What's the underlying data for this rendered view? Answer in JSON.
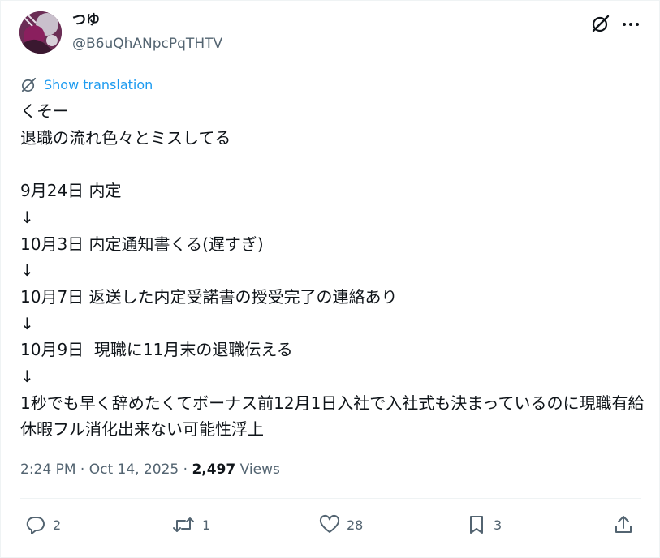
{
  "author": {
    "display_name": "つゆ",
    "handle": "@B6uQhANpcPqTHTV",
    "avatar_icon": "avatar-image"
  },
  "header_icons": [
    "grok-icon",
    "more-icon"
  ],
  "translate": {
    "label": "Show translation",
    "icon": "translate-icon"
  },
  "post": {
    "text": "くそー\n退職の流れ色々とミスしてる\n\n9月24日 内定\n↓\n10月3日 内定通知書くる(遅すぎ)\n↓\n10月7日 返送した内定受諾書の授受完了の連絡あり\n↓\n10月9日  現職に11月末の退職伝える\n↓\n1秒でも早く辞めたくてボーナス前12月1日入社で入社式も決まっているのに現職有給休暇フル消化出来ない可能性浮上"
  },
  "meta": {
    "time": "2:24 PM",
    "separator": "·",
    "date": "Oct 14, 2025",
    "views_count": "2,497",
    "views_label": "Views"
  },
  "actions": {
    "reply": {
      "icon": "reply-icon",
      "count": "2"
    },
    "repost": {
      "icon": "repost-icon",
      "count": "1"
    },
    "like": {
      "icon": "heart-icon",
      "count": "28"
    },
    "bookmark": {
      "icon": "bookmark-icon",
      "count": "3"
    },
    "share": {
      "icon": "share-icon"
    }
  },
  "colors": {
    "text": "#0f1419",
    "secondary": "#536471",
    "link": "#1d9bf0",
    "border": "#eff3f4"
  }
}
